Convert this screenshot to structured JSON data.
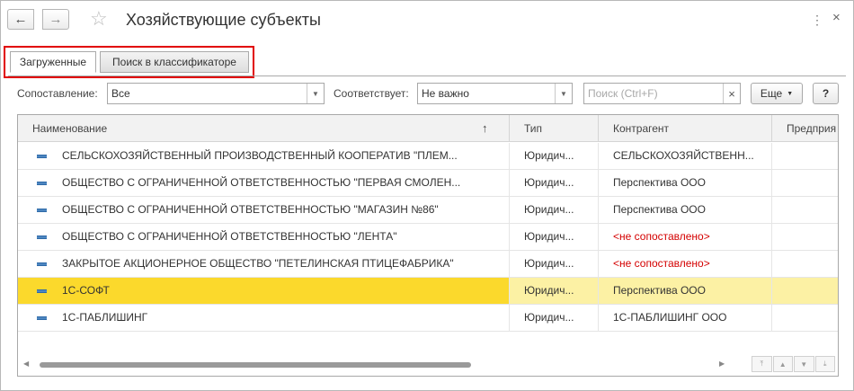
{
  "window": {
    "title": "Хозяйствующие субъекты",
    "back_glyph": "←",
    "forward_glyph": "→",
    "star_glyph": "☆",
    "more_glyph": "⋮",
    "close_glyph": "×"
  },
  "tabs": [
    {
      "label": "Загруженные",
      "active": true
    },
    {
      "label": "Поиск в классификаторе",
      "active": false
    }
  ],
  "filters": {
    "match_label": "Сопоставление:",
    "match_value": "Все",
    "corresponds_label": "Соответствует:",
    "corresponds_value": "Не важно",
    "search_placeholder": "Поиск (Ctrl+F)",
    "clear_glyph": "×",
    "more_button": "Еще",
    "help_button": "?"
  },
  "table": {
    "columns": [
      "Наименование",
      "Тип",
      "Контрагент",
      "Предприя"
    ],
    "sort_glyph": "↑",
    "rows": [
      {
        "name": "СЕЛЬСКОХОЗЯЙСТВЕННЫЙ ПРОИЗВОДСТВЕННЫЙ КООПЕРАТИВ \"ПЛЕМ...",
        "type": "Юридич...",
        "counterparty": "СЕЛЬСКОХОЗЯЙСТВЕНН...",
        "enterprise": "",
        "unmatched": false,
        "selected": false
      },
      {
        "name": "ОБЩЕСТВО С ОГРАНИЧЕННОЙ ОТВЕТСТВЕННОСТЬЮ \"ПЕРВАЯ СМОЛЕН...",
        "type": "Юридич...",
        "counterparty": "Перспектива ООО",
        "enterprise": "",
        "unmatched": false,
        "selected": false
      },
      {
        "name": "ОБЩЕСТВО С ОГРАНИЧЕННОЙ ОТВЕТСТВЕННОСТЬЮ \"МАГАЗИН №86\"",
        "type": "Юридич...",
        "counterparty": "Перспектива ООО",
        "enterprise": "",
        "unmatched": false,
        "selected": false
      },
      {
        "name": "ОБЩЕСТВО С ОГРАНИЧЕННОЙ ОТВЕТСТВЕННОСТЬЮ \"ЛЕНТА\"",
        "type": "Юридич...",
        "counterparty": "<не сопоставлено>",
        "enterprise": "",
        "unmatched": true,
        "selected": false
      },
      {
        "name": "ЗАКРЫТОЕ АКЦИОНЕРНОЕ ОБЩЕСТВО \"ПЕТЕЛИНСКАЯ ПТИЦЕФАБРИКА\"",
        "type": "Юридич...",
        "counterparty": "<не сопоставлено>",
        "enterprise": "",
        "unmatched": true,
        "selected": false
      },
      {
        "name": "1С-СОФТ",
        "type": "Юридич...",
        "counterparty": "Перспектива ООО",
        "enterprise": "",
        "unmatched": false,
        "selected": true
      },
      {
        "name": "1С-ПАБЛИШИНГ",
        "type": "Юридич...",
        "counterparty": "1С-ПАБЛИШИНГ ООО",
        "enterprise": "",
        "unmatched": false,
        "selected": false
      }
    ]
  },
  "colors": {
    "selected_row": "#fbd92c",
    "selected_row_light": "#fcf1a4",
    "unmatched_text": "#d40000",
    "tab_highlight": "#e10000"
  }
}
